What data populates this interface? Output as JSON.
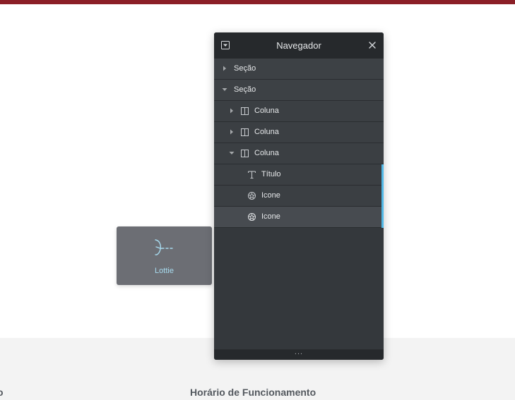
{
  "page": {
    "footer_left_text": "o",
    "footer_right_text": "Horário de Funcionamento"
  },
  "drag_widget": {
    "label": "Lottie",
    "icon": "lottie-icon"
  },
  "navigator": {
    "title": "Navegador",
    "toggle_icon": "collapse-toggle-icon",
    "close_icon": "close-icon",
    "footer_text": "...",
    "rows": [
      {
        "label": "Seção",
        "icon": "caret-right-icon",
        "expanded": false
      },
      {
        "label": "Seção",
        "icon": "caret-down-icon",
        "expanded": true
      },
      {
        "label": "Coluna",
        "icon": "column-icon",
        "expanded": false
      },
      {
        "label": "Coluna",
        "icon": "column-icon",
        "expanded": false
      },
      {
        "label": "Coluna",
        "icon": "column-icon",
        "expanded": true
      },
      {
        "label": "Título",
        "icon": "heading-icon"
      },
      {
        "label": "Icone",
        "icon": "icon-widget-icon"
      },
      {
        "label": "Icone",
        "icon": "icon-widget-icon",
        "selected": true
      }
    ]
  },
  "colors": {
    "top_bar": "#8b1f27",
    "panel_bg": "#34383c",
    "header_bg": "#26292c",
    "accent_blue": "#51b8e6",
    "lottie_label": "#a8dcf0"
  }
}
